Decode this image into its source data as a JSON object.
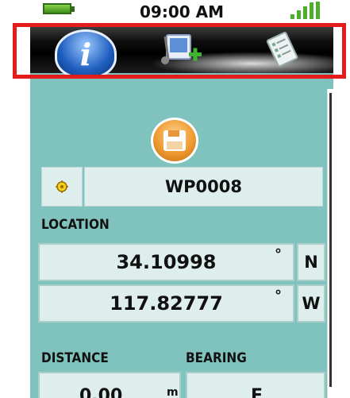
{
  "status_bar": {
    "time": "09:00 AM",
    "battery_icon": "battery-icon",
    "signal_icon": "signal-icon"
  },
  "toolbar": {
    "items": [
      {
        "icon": "info-icon"
      },
      {
        "icon": "add-media-icon"
      },
      {
        "icon": "checklist-icon"
      }
    ]
  },
  "waypoint": {
    "save_icon": "save-icon",
    "name_icon": "waypoint-symbol-icon",
    "name": "WP0008"
  },
  "location": {
    "label": "LOCATION",
    "latitude": "34.10998",
    "lat_degree": "°",
    "lat_dir": "N",
    "longitude": "117.82777",
    "lon_degree": "°",
    "lon_dir": "W"
  },
  "distance": {
    "label": "DISTANCE",
    "value_partial": "0.00",
    "unit_partial": "m"
  },
  "bearing": {
    "label": "BEARING",
    "value_partial": "E"
  },
  "colors": {
    "highlight": "#e31b1b",
    "panel": "#80c2bd",
    "field": "#deeeed"
  }
}
